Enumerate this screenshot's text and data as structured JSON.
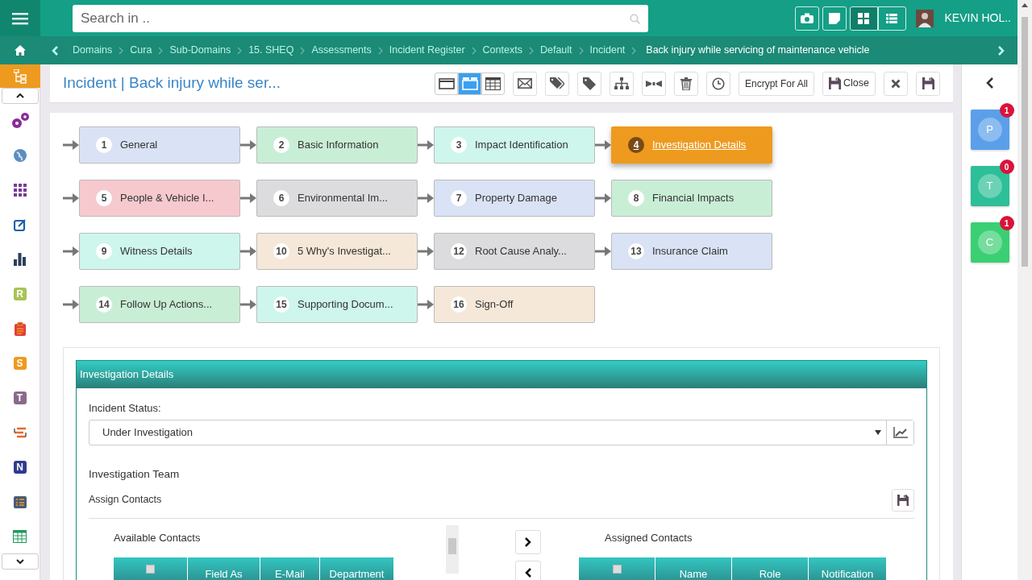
{
  "search": {
    "placeholder": "Search in .."
  },
  "view_toggle": [
    {
      "selected": true
    },
    {
      "selected": false
    }
  ],
  "user": {
    "name": "KEVIN HOL.."
  },
  "breadcrumbs": [
    {
      "label": "Domains",
      "current": false
    },
    {
      "label": "Cura",
      "current": false
    },
    {
      "label": "Sub-Domains",
      "current": false
    },
    {
      "label": "15. SHEQ",
      "current": false
    },
    {
      "label": "Assessments",
      "current": false
    },
    {
      "label": "Incident Register",
      "current": false
    },
    {
      "label": "Contexts",
      "current": false
    },
    {
      "label": "Default",
      "current": false
    },
    {
      "label": "Incident",
      "current": false
    },
    {
      "label": "Back injury while servicing of maintenance vehicle",
      "current": true
    }
  ],
  "sidebar": {
    "items": [
      {
        "kind": "icon",
        "selected": true
      },
      {
        "kind": "icon",
        "selected": false
      },
      {
        "kind": "icon",
        "selected": false
      },
      {
        "kind": "icon",
        "selected": false
      },
      {
        "kind": "icon",
        "selected": false
      },
      {
        "kind": "icon",
        "selected": false
      },
      {
        "kind": "letter",
        "text": "R",
        "color": "#a8c356",
        "selected": false
      },
      {
        "kind": "icon",
        "selected": false
      },
      {
        "kind": "letter",
        "text": "S",
        "color": "#ee9a1e",
        "selected": false
      },
      {
        "kind": "letter",
        "text": "T",
        "color": "#8a6a8a",
        "selected": false
      },
      {
        "kind": "icon",
        "selected": false
      },
      {
        "kind": "letter",
        "text": "N",
        "color": "#2f3b8f",
        "selected": false
      },
      {
        "kind": "icon",
        "selected": false
      },
      {
        "kind": "icon",
        "selected": false
      }
    ]
  },
  "page_title": "Incident | Back injury while ser...",
  "view_modes": [
    {
      "selected": false
    },
    {
      "selected": true
    },
    {
      "selected": false
    }
  ],
  "encrypt_button": "Encrypt For All",
  "close_button": "Close",
  "steps": [
    {
      "number": "1",
      "label": "General",
      "color": "#d9e3f5",
      "selected": false
    },
    {
      "number": "2",
      "label": "Basic Information",
      "color": "#c9eed6",
      "selected": false
    },
    {
      "number": "3",
      "label": "Impact Identification",
      "color": "#cef6ec",
      "selected": false
    },
    {
      "number": "4",
      "label": "Investigation Details",
      "color": "#ee9a1e",
      "selected": true
    },
    {
      "number": "5",
      "label": "People & Vehicle I...",
      "color": "#f6c9ce",
      "selected": false
    },
    {
      "number": "6",
      "label": "Environmental Im...",
      "color": "#dcdcdf",
      "selected": false
    },
    {
      "number": "7",
      "label": "Property Damage",
      "color": "#d9e3f5",
      "selected": false
    },
    {
      "number": "8",
      "label": "Financial Impacts",
      "color": "#c9eed6",
      "selected": false
    },
    {
      "number": "9",
      "label": "Witness Details",
      "color": "#cef6ec",
      "selected": false
    },
    {
      "number": "10",
      "label": "5 Why's Investigat...",
      "color": "#f5e8d8",
      "selected": false
    },
    {
      "number": "12",
      "label": "Root Cause Analy...",
      "color": "#dcdcdf",
      "selected": false
    },
    {
      "number": "13",
      "label": "Insurance Claim",
      "color": "#d9e3f5",
      "selected": false
    },
    {
      "number": "14",
      "label": "Follow Up Actions...",
      "color": "#c9eed6",
      "selected": false
    },
    {
      "number": "15",
      "label": "Supporting Docum...",
      "color": "#cef6ec",
      "selected": false
    },
    {
      "number": "16",
      "label": "Sign-Off",
      "color": "#f5e8d8",
      "selected": false
    }
  ],
  "panel": {
    "title": "Investigation Details",
    "status_label": "Incident Status:",
    "status_value": "Under Investigation",
    "team_label": "Investigation Team",
    "assign_label": "Assign Contacts",
    "available": {
      "title": "Available Contacts",
      "select_all_checked": false,
      "columns": [
        "Field As",
        "E-Mail",
        "Department"
      ]
    },
    "assigned": {
      "title": "Assigned Contacts",
      "select_all_checked": false,
      "columns": [
        "Name",
        "Role",
        "Notification"
      ]
    }
  },
  "right_tiles": [
    {
      "letter": "P",
      "count": "1",
      "color": "#5b9fea"
    },
    {
      "letter": "T",
      "count": "0",
      "color": "#2dbf97"
    },
    {
      "letter": "C",
      "count": "1",
      "color": "#3bcf74"
    }
  ]
}
